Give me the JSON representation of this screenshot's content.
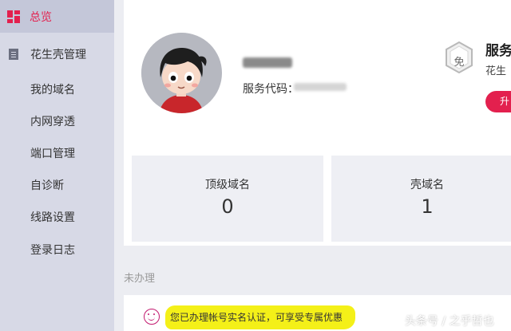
{
  "sidebar": {
    "active_item": {
      "label": "总览",
      "icon": "dashboard-icon"
    },
    "group": {
      "label": "花生壳管理",
      "icon": "document-icon"
    },
    "items": [
      {
        "label": "我的域名"
      },
      {
        "label": "内网穿透"
      },
      {
        "label": "端口管理"
      },
      {
        "label": "自诊断"
      },
      {
        "label": "线路设置"
      },
      {
        "label": "登录日志"
      }
    ]
  },
  "profile": {
    "avatar_icon": "cartoon-avatar",
    "service_code_label": "服务代码：",
    "badge_char": "免",
    "service_title": "服务",
    "service_subtitle": "花生",
    "upgrade_label": "升"
  },
  "stats": [
    {
      "label": "顶级域名",
      "value": "0"
    },
    {
      "label": "壳域名",
      "value": "1"
    }
  ],
  "pending": {
    "section_title": "未办理",
    "notice_text": "您已办理帐号实名认证，可享受专属优惠",
    "notice_icon": "smiley-icon"
  },
  "watermark": "头条号 / 之乎哲也",
  "colors": {
    "accent": "#e3204e",
    "sidebar_bg": "#d7d9e6",
    "highlight": "#f4f018"
  }
}
